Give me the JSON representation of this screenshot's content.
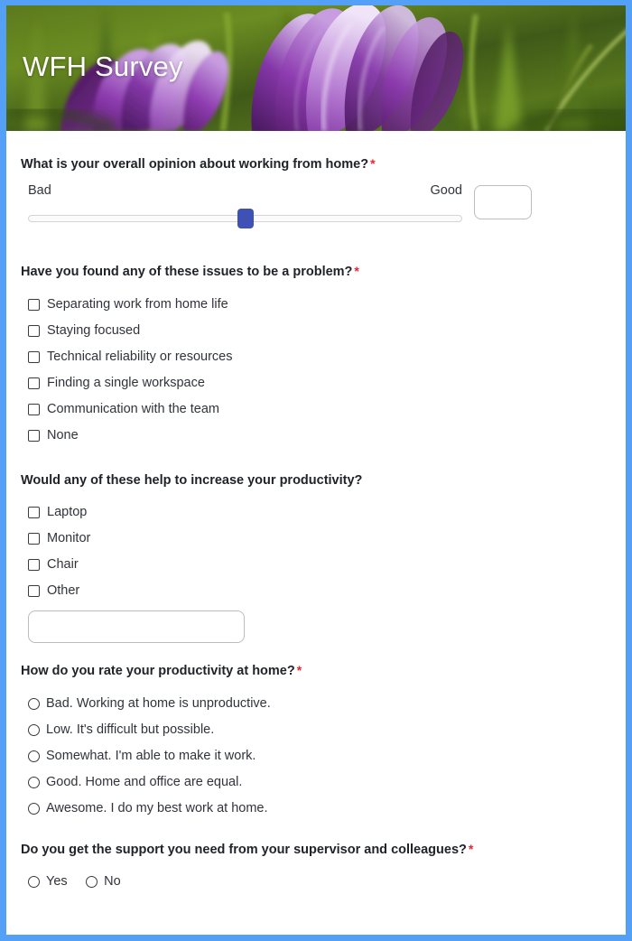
{
  "banner": {
    "title": "WFH Survey",
    "image_alt": "purple-crocus-flowers-photo"
  },
  "theme": {
    "border_color": "#55a0f7",
    "accent_color": "#3f51b5",
    "required_color": "#e8262c",
    "text_color": "#30343a",
    "heading_color": "#1f2226"
  },
  "questions": [
    {
      "id": "overall-opinion",
      "title": "What is your overall opinion about working from home?",
      "required": true,
      "required_mark": "*",
      "type": "slider",
      "slider": {
        "left_label": "Bad",
        "right_label": "Good",
        "value": "",
        "value_placeholder": "",
        "thumb_percent": 50
      }
    },
    {
      "id": "issues-problem",
      "title": "Have you found any of these issues to be a problem?",
      "required": true,
      "required_mark": "*",
      "type": "checkbox",
      "options": [
        "Separating work from home life",
        "Staying focused",
        "Technical reliability or resources",
        "Finding a single workspace",
        "Communication with the team",
        "None"
      ]
    },
    {
      "id": "increase-productivity",
      "title": "Would any of these help to increase your productivity?",
      "required": false,
      "required_mark": "",
      "type": "checkbox",
      "options": [
        "Laptop",
        "Monitor",
        "Chair",
        "Other"
      ],
      "other_input": {
        "value": "",
        "placeholder": ""
      }
    },
    {
      "id": "rate-productivity",
      "title": "How do you rate your productivity at home?",
      "required": true,
      "required_mark": "*",
      "type": "radio",
      "options": [
        "Bad. Working at home is unproductive.",
        "Low. It's difficult but possible.",
        "Somewhat. I'm able to make it work.",
        "Good. Home and office are equal.",
        "Awesome. I do my best work at home."
      ]
    },
    {
      "id": "support-needed",
      "title": "Do you get the support you need from your supervisor and colleagues?",
      "required": true,
      "required_mark": "*",
      "type": "radio-inline",
      "options": [
        "Yes",
        "No"
      ]
    }
  ]
}
